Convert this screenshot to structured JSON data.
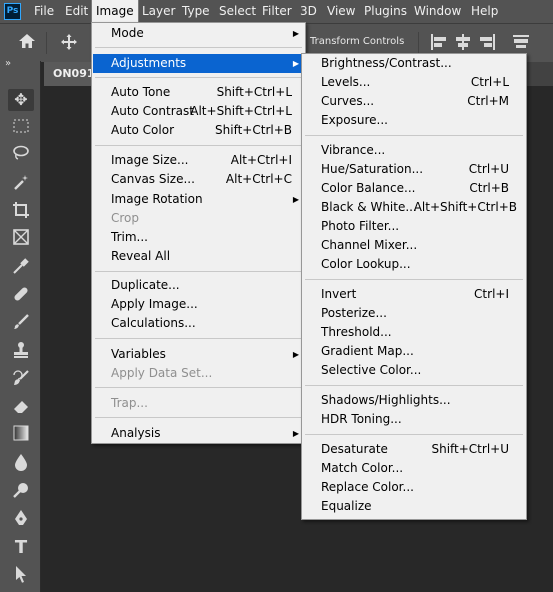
{
  "app": {
    "logo_text": "Ps"
  },
  "menubar": {
    "items": [
      "File",
      "Edit",
      "Image",
      "Layer",
      "Type",
      "Select",
      "Filter",
      "3D",
      "View",
      "Plugins",
      "Window",
      "Help"
    ],
    "open_menu": "Image"
  },
  "options_bar": {
    "transform_controls_label": "Transform Controls",
    "icons": [
      "home-icon",
      "move-icon",
      "align-left-icon",
      "align-center-icon",
      "align-right-icon",
      "align-top-icon"
    ]
  },
  "tools_panel": {
    "collapse_glyph": "»",
    "tools": [
      "move-tool-icon",
      "marquee-tool-icon",
      "lasso-tool-icon",
      "magic-wand-tool-icon",
      "crop-tool-icon",
      "frame-tool-icon",
      "eyedropper-tool-icon",
      "healing-tool-icon",
      "brush-tool-icon",
      "stamp-tool-icon",
      "history-brush-tool-icon",
      "eraser-tool-icon",
      "gradient-tool-icon",
      "blur-tool-icon",
      "dodge-tool-icon",
      "pen-tool-icon",
      "type-tool-icon",
      "path-selection-tool-icon"
    ]
  },
  "document": {
    "tab_title": "ON091"
  },
  "image_menu": {
    "items": [
      {
        "label": "Mode",
        "submenu": true
      },
      {
        "label": "Adjustments",
        "submenu": true,
        "highlight": true
      },
      {
        "label": "Auto Tone",
        "shortcut": "Shift+Ctrl+L"
      },
      {
        "label": "Auto Contrast",
        "shortcut": "Alt+Shift+Ctrl+L"
      },
      {
        "label": "Auto Color",
        "shortcut": "Shift+Ctrl+B"
      },
      {
        "label": "Image Size...",
        "shortcut": "Alt+Ctrl+I"
      },
      {
        "label": "Canvas Size...",
        "shortcut": "Alt+Ctrl+C"
      },
      {
        "label": "Image Rotation",
        "submenu": true
      },
      {
        "label": "Crop",
        "disabled": true
      },
      {
        "label": "Trim..."
      },
      {
        "label": "Reveal All"
      },
      {
        "label": "Duplicate..."
      },
      {
        "label": "Apply Image..."
      },
      {
        "label": "Calculations..."
      },
      {
        "label": "Variables",
        "submenu": true
      },
      {
        "label": "Apply Data Set...",
        "disabled": true
      },
      {
        "label": "Trap...",
        "disabled": true
      },
      {
        "label": "Analysis",
        "submenu": true
      }
    ]
  },
  "adjustments_menu": {
    "items": [
      {
        "label": "Brightness/Contrast..."
      },
      {
        "label": "Levels...",
        "shortcut": "Ctrl+L"
      },
      {
        "label": "Curves...",
        "shortcut": "Ctrl+M"
      },
      {
        "label": "Exposure..."
      },
      {
        "label": "Vibrance..."
      },
      {
        "label": "Hue/Saturation...",
        "shortcut": "Ctrl+U"
      },
      {
        "label": "Color Balance...",
        "shortcut": "Ctrl+B"
      },
      {
        "label": "Black & White...",
        "shortcut": "Alt+Shift+Ctrl+B"
      },
      {
        "label": "Photo Filter..."
      },
      {
        "label": "Channel Mixer..."
      },
      {
        "label": "Color Lookup..."
      },
      {
        "label": "Invert",
        "shortcut": "Ctrl+I"
      },
      {
        "label": "Posterize..."
      },
      {
        "label": "Threshold..."
      },
      {
        "label": "Gradient Map..."
      },
      {
        "label": "Selective Color..."
      },
      {
        "label": "Shadows/Highlights..."
      },
      {
        "label": "HDR Toning..."
      },
      {
        "label": "Desaturate",
        "shortcut": "Shift+Ctrl+U"
      },
      {
        "label": "Match Color..."
      },
      {
        "label": "Replace Color..."
      },
      {
        "label": "Equalize"
      }
    ]
  },
  "colors": {
    "menu_highlight": "#0a64d0",
    "chrome": "#535353",
    "canvas": "#282828",
    "menu_bg": "#f0f0f0"
  }
}
